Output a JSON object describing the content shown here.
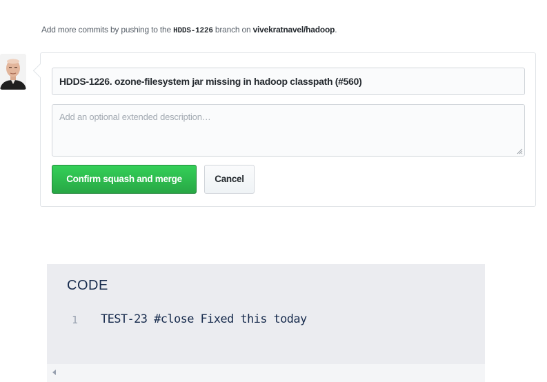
{
  "hint": {
    "prefix": "Add more commits by pushing to the ",
    "branch": "HDDS-1226",
    "middle": " branch on ",
    "repo": "vivekratnavel/hadoop",
    "suffix": "."
  },
  "merge_form": {
    "commit_title": "HDDS-1226. ozone-filesystem jar missing in hadoop classpath (#560)",
    "description_placeholder": "Add an optional extended description…",
    "confirm_label": "Confirm squash and merge",
    "cancel_label": "Cancel"
  },
  "code_block": {
    "title": "CODE",
    "lines": [
      {
        "number": "1",
        "text": "TEST-23 #close Fixed this today"
      }
    ]
  },
  "colors": {
    "confirm_green": "#2cbe4e",
    "code_background": "#ebecf0"
  }
}
